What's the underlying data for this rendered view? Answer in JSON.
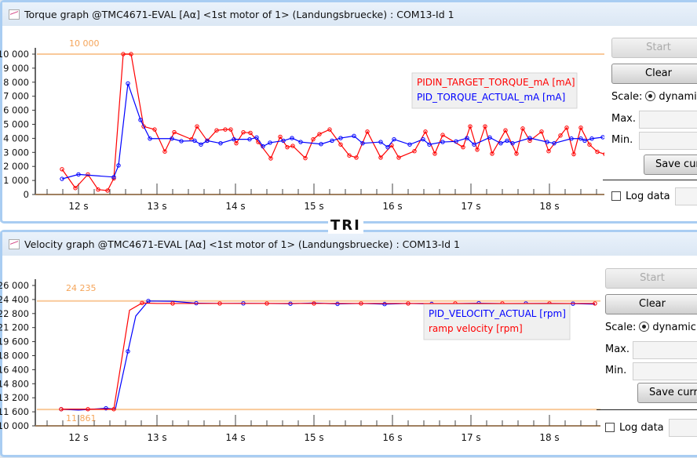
{
  "torque_window": {
    "title": "Torque graph @TMC4671-EVAL [Aα] <1st motor of 1> (Landungsbruecke) : COM13-Id 1",
    "icon": "graph-icon",
    "start_label": "Start",
    "clear_label": "Clear",
    "scale_label": "Scale:",
    "scale_option": "dynamic",
    "max_label": "Max.",
    "min_label": "Min.",
    "save_label": "Save curr",
    "log_label": "Log data"
  },
  "velocity_window": {
    "title": "Velocity graph @TMC4671-EVAL [Aα] <1st motor of 1> (Landungsbruecke) : COM13-Id 1",
    "icon": "graph-icon",
    "start_label": "Start",
    "clear_label": "Clear",
    "scale_label": "Scale:",
    "scale_option": "dynamic",
    "max_label": "Max.",
    "min_label": "Min.",
    "save_label": "Save curre",
    "log_label": "Log data"
  },
  "background_text": "TRI",
  "chart_data": [
    {
      "type": "line",
      "title": "Torque graph",
      "xlim": [
        11.47,
        18.71
      ],
      "ylim": [
        0,
        10000
      ],
      "x_ticks": [
        12,
        13,
        14,
        15,
        16,
        17,
        18
      ],
      "x_tick_labels": [
        "12 s",
        "13 s",
        "14 s",
        "15 s",
        "16 s",
        "17 s",
        "18 s"
      ],
      "y_ticks": [
        0,
        1000,
        2000,
        3000,
        4000,
        5000,
        6000,
        7000,
        8000,
        9000,
        10000
      ],
      "y_tick_labels": [
        "0",
        "1 000",
        "2 000",
        "3 000",
        "4 000",
        "5 000",
        "6 000",
        "7 000",
        "8 000",
        "9 000",
        "10 000"
      ],
      "ref_lines": [
        {
          "value": 10000,
          "label": "10 000"
        }
      ],
      "legend": "top-right",
      "series": [
        {
          "name": "PIDIN_TARGET_TORQUE_mA [mA]",
          "color": "#ff0000",
          "x": [
            11.79,
            11.96,
            12.12,
            12.25,
            12.37,
            12.45,
            12.57,
            12.67,
            12.83,
            12.97,
            13.1,
            13.22,
            13.44,
            13.51,
            13.64,
            13.76,
            13.87,
            13.94,
            14.01,
            14.1,
            14.19,
            14.29,
            14.45,
            14.57,
            14.66,
            14.73,
            14.89,
            14.99,
            15.07,
            15.2,
            15.34,
            15.45,
            15.54,
            15.68,
            15.85,
            15.99,
            16.08,
            16.28,
            16.42,
            16.54,
            16.64,
            16.9,
            16.99,
            17.08,
            17.18,
            17.27,
            17.44,
            17.58,
            17.66,
            17.75,
            17.9,
            17.99,
            18.14,
            18.22,
            18.31,
            18.4,
            18.51,
            18.61,
            18.71
          ],
          "y": [
            1800,
            460,
            1430,
            350,
            280,
            1150,
            10000,
            10000,
            4850,
            4630,
            3060,
            4440,
            3930,
            4850,
            3830,
            4570,
            4630,
            4630,
            3650,
            4430,
            4390,
            3740,
            2570,
            4110,
            3370,
            3460,
            2590,
            3930,
            4300,
            4630,
            3560,
            2780,
            2630,
            4480,
            2630,
            3500,
            2630,
            3090,
            4480,
            2910,
            4240,
            3370,
            4850,
            3190,
            4850,
            2910,
            4570,
            2910,
            4700,
            3830,
            4480,
            3090,
            4200,
            4760,
            2870,
            4760,
            3560,
            3040,
            2870
          ]
        },
        {
          "name": "PID_TORQUE_ACTUAL_mA [mA]",
          "color": "#0000ff",
          "x": [
            11.79,
            12.0,
            12.45,
            12.51,
            12.63,
            12.79,
            12.91,
            13.19,
            13.31,
            13.48,
            13.56,
            13.64,
            13.81,
            13.98,
            14.18,
            14.27,
            14.35,
            14.44,
            14.61,
            14.72,
            14.83,
            15.09,
            15.23,
            15.34,
            15.51,
            15.62,
            15.85,
            15.94,
            16.02,
            16.22,
            16.39,
            16.47,
            16.64,
            16.81,
            16.95,
            17.04,
            17.24,
            17.38,
            17.46,
            17.53,
            17.75,
            17.97,
            18.06,
            18.28,
            18.4,
            18.45,
            18.54,
            18.68
          ],
          "y": [
            1110,
            1430,
            1240,
            2070,
            7910,
            5310,
            3980,
            3980,
            3800,
            3830,
            3560,
            3830,
            3650,
            3930,
            3930,
            4060,
            3430,
            3690,
            3830,
            4020,
            3740,
            3590,
            3830,
            4020,
            4170,
            3650,
            3740,
            3370,
            3930,
            3560,
            3930,
            3560,
            3740,
            3780,
            4020,
            3560,
            4060,
            3650,
            3830,
            3650,
            4020,
            3740,
            3650,
            3980,
            3980,
            3830,
            3980,
            4080
          ]
        }
      ]
    },
    {
      "type": "line",
      "title": "Velocity graph",
      "xlim": [
        11.47,
        18.6
      ],
      "ylim": [
        10000,
        26000
      ],
      "x_ticks": [
        12,
        13,
        14,
        15,
        16,
        17,
        18
      ],
      "x_tick_labels": [
        "12 s",
        "13 s",
        "14 s",
        "15 s",
        "16 s",
        "17 s",
        "18 s"
      ],
      "y_ticks": [
        10000,
        11600,
        13200,
        14800,
        16400,
        18000,
        19600,
        21200,
        22800,
        24400,
        26000
      ],
      "y_tick_labels": [
        "10 000",
        "11 600",
        "13 200",
        "14 800",
        "16 400",
        "18 000",
        "19 600",
        "21 200",
        "22 800",
        "24 400",
        "26 000"
      ],
      "ref_lines": [
        {
          "value": 24235,
          "label": "24 235"
        },
        {
          "value": 11861,
          "label": "11 861"
        }
      ],
      "legend": "center-right",
      "series": [
        {
          "name": "PID_VELOCITY_ACTUAL [rpm]",
          "color": "#0000ff",
          "x": [
            11.78,
            12.0,
            12.35,
            12.47,
            12.63,
            12.73,
            12.89,
            13.2,
            13.5,
            13.8,
            14.1,
            14.4,
            14.7,
            15.0,
            15.3,
            15.6,
            15.9,
            16.2,
            16.5,
            16.8,
            17.1,
            17.4,
            17.7,
            18.0,
            18.3,
            18.58
          ],
          "y": [
            11900,
            11800,
            12000,
            11900,
            18490,
            22520,
            24230,
            24200,
            23980,
            23950,
            23960,
            23950,
            23920,
            24000,
            23900,
            23950,
            23880,
            23950,
            23900,
            23930,
            23980,
            23940,
            23950,
            23960,
            23930,
            23880
          ]
        },
        {
          "name": "ramp velocity [rpm]",
          "color": "#ff0000",
          "x": [
            11.78,
            12.0,
            12.12,
            12.35,
            12.45,
            12.65,
            12.81,
            13.0,
            13.2,
            13.5,
            13.8,
            14.1,
            14.4,
            14.7,
            15.0,
            15.3,
            15.6,
            15.9,
            16.2,
            16.5,
            16.8,
            17.1,
            17.4,
            17.7,
            18.0,
            18.3,
            18.58
          ],
          "y": [
            11900,
            11900,
            11900,
            11900,
            11900,
            23170,
            24000,
            23950,
            23950,
            23950,
            23950,
            23950,
            23950,
            23950,
            23950,
            23950,
            23950,
            23950,
            23950,
            23950,
            23950,
            23950,
            23950,
            23950,
            23950,
            23950,
            23950
          ]
        }
      ]
    }
  ]
}
